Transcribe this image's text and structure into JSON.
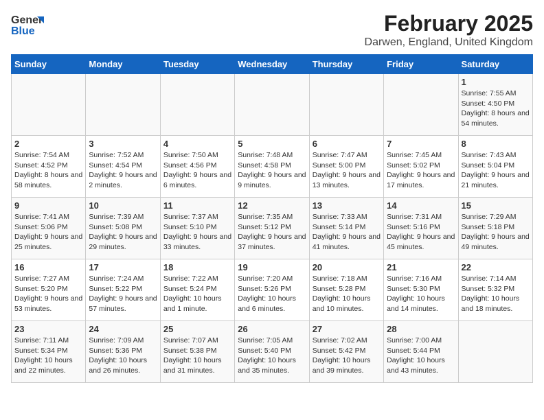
{
  "header": {
    "logo_general": "General",
    "logo_blue": "Blue",
    "month_title": "February 2025",
    "location": "Darwen, England, United Kingdom"
  },
  "days_of_week": [
    "Sunday",
    "Monday",
    "Tuesday",
    "Wednesday",
    "Thursday",
    "Friday",
    "Saturday"
  ],
  "weeks": [
    [
      {
        "day": "",
        "info": ""
      },
      {
        "day": "",
        "info": ""
      },
      {
        "day": "",
        "info": ""
      },
      {
        "day": "",
        "info": ""
      },
      {
        "day": "",
        "info": ""
      },
      {
        "day": "",
        "info": ""
      },
      {
        "day": "1",
        "info": "Sunrise: 7:55 AM\nSunset: 4:50 PM\nDaylight: 8 hours and 54 minutes."
      }
    ],
    [
      {
        "day": "2",
        "info": "Sunrise: 7:54 AM\nSunset: 4:52 PM\nDaylight: 8 hours and 58 minutes."
      },
      {
        "day": "3",
        "info": "Sunrise: 7:52 AM\nSunset: 4:54 PM\nDaylight: 9 hours and 2 minutes."
      },
      {
        "day": "4",
        "info": "Sunrise: 7:50 AM\nSunset: 4:56 PM\nDaylight: 9 hours and 6 minutes."
      },
      {
        "day": "5",
        "info": "Sunrise: 7:48 AM\nSunset: 4:58 PM\nDaylight: 9 hours and 9 minutes."
      },
      {
        "day": "6",
        "info": "Sunrise: 7:47 AM\nSunset: 5:00 PM\nDaylight: 9 hours and 13 minutes."
      },
      {
        "day": "7",
        "info": "Sunrise: 7:45 AM\nSunset: 5:02 PM\nDaylight: 9 hours and 17 minutes."
      },
      {
        "day": "8",
        "info": "Sunrise: 7:43 AM\nSunset: 5:04 PM\nDaylight: 9 hours and 21 minutes."
      }
    ],
    [
      {
        "day": "9",
        "info": "Sunrise: 7:41 AM\nSunset: 5:06 PM\nDaylight: 9 hours and 25 minutes."
      },
      {
        "day": "10",
        "info": "Sunrise: 7:39 AM\nSunset: 5:08 PM\nDaylight: 9 hours and 29 minutes."
      },
      {
        "day": "11",
        "info": "Sunrise: 7:37 AM\nSunset: 5:10 PM\nDaylight: 9 hours and 33 minutes."
      },
      {
        "day": "12",
        "info": "Sunrise: 7:35 AM\nSunset: 5:12 PM\nDaylight: 9 hours and 37 minutes."
      },
      {
        "day": "13",
        "info": "Sunrise: 7:33 AM\nSunset: 5:14 PM\nDaylight: 9 hours and 41 minutes."
      },
      {
        "day": "14",
        "info": "Sunrise: 7:31 AM\nSunset: 5:16 PM\nDaylight: 9 hours and 45 minutes."
      },
      {
        "day": "15",
        "info": "Sunrise: 7:29 AM\nSunset: 5:18 PM\nDaylight: 9 hours and 49 minutes."
      }
    ],
    [
      {
        "day": "16",
        "info": "Sunrise: 7:27 AM\nSunset: 5:20 PM\nDaylight: 9 hours and 53 minutes."
      },
      {
        "day": "17",
        "info": "Sunrise: 7:24 AM\nSunset: 5:22 PM\nDaylight: 9 hours and 57 minutes."
      },
      {
        "day": "18",
        "info": "Sunrise: 7:22 AM\nSunset: 5:24 PM\nDaylight: 10 hours and 1 minute."
      },
      {
        "day": "19",
        "info": "Sunrise: 7:20 AM\nSunset: 5:26 PM\nDaylight: 10 hours and 6 minutes."
      },
      {
        "day": "20",
        "info": "Sunrise: 7:18 AM\nSunset: 5:28 PM\nDaylight: 10 hours and 10 minutes."
      },
      {
        "day": "21",
        "info": "Sunrise: 7:16 AM\nSunset: 5:30 PM\nDaylight: 10 hours and 14 minutes."
      },
      {
        "day": "22",
        "info": "Sunrise: 7:14 AM\nSunset: 5:32 PM\nDaylight: 10 hours and 18 minutes."
      }
    ],
    [
      {
        "day": "23",
        "info": "Sunrise: 7:11 AM\nSunset: 5:34 PM\nDaylight: 10 hours and 22 minutes."
      },
      {
        "day": "24",
        "info": "Sunrise: 7:09 AM\nSunset: 5:36 PM\nDaylight: 10 hours and 26 minutes."
      },
      {
        "day": "25",
        "info": "Sunrise: 7:07 AM\nSunset: 5:38 PM\nDaylight: 10 hours and 31 minutes."
      },
      {
        "day": "26",
        "info": "Sunrise: 7:05 AM\nSunset: 5:40 PM\nDaylight: 10 hours and 35 minutes."
      },
      {
        "day": "27",
        "info": "Sunrise: 7:02 AM\nSunset: 5:42 PM\nDaylight: 10 hours and 39 minutes."
      },
      {
        "day": "28",
        "info": "Sunrise: 7:00 AM\nSunset: 5:44 PM\nDaylight: 10 hours and 43 minutes."
      },
      {
        "day": "",
        "info": ""
      }
    ]
  ]
}
